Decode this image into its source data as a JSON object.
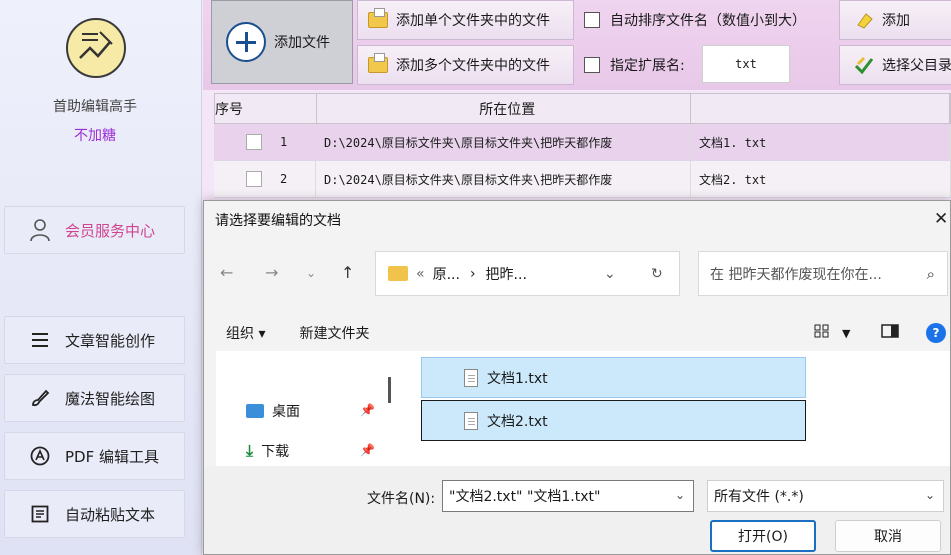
{
  "sidebar": {
    "app_name": "首助编辑高手",
    "app_sub": "不加糖",
    "member": "会员服务中心",
    "items": [
      {
        "label": "文章智能创作",
        "icon": "menu-lines-icon"
      },
      {
        "label": "魔法智能绘图",
        "icon": "brush-icon"
      },
      {
        "label": "PDF 编辑工具",
        "icon": "pdf-icon"
      },
      {
        "label": "自动粘贴文本",
        "icon": "clipboard-icon"
      }
    ]
  },
  "toolbar": {
    "add_file": "添加文件",
    "add_single_folder": "添加单个文件夹中的文件",
    "add_multi_folder": "添加多个文件夹中的文件",
    "auto_sort": "自动排序文件名（数值小到大）",
    "specify_ext": "指定扩展名:",
    "ext_value": "txt",
    "add_right": "添加",
    "select_parent": "选择父目录"
  },
  "table": {
    "headers": [
      "序号",
      "所在位置"
    ],
    "rows": [
      {
        "index": "1",
        "path": "D:\\2024\\原目标文件夹\\原目标文件夹\\把昨天都作废",
        "name": "文档1. txt"
      },
      {
        "index": "2",
        "path": "D:\\2024\\原目标文件夹\\原目标文件夹\\把昨天都作废",
        "name": "文档2. txt"
      }
    ]
  },
  "dialog": {
    "title": "请选择要编辑的文档",
    "breadcrumb": [
      "«",
      "原...",
      "›",
      "把昨..."
    ],
    "search_placeholder": "在 把昨天都作废现在你在...",
    "organize": "组织 ▾",
    "new_folder": "新建文件夹",
    "nav_items": [
      {
        "label": "桌面",
        "icon": "desktop-icon"
      },
      {
        "label": "下载",
        "icon": "download-icon"
      }
    ],
    "files": [
      "文档1.txt",
      "文档2.txt"
    ],
    "filename_label": "文件名(N):",
    "filename_value": "\"文档2.txt\" \"文档1.txt\"",
    "filetype": "所有文件 (*.*)",
    "open": "打开(O)",
    "cancel": "取消"
  }
}
